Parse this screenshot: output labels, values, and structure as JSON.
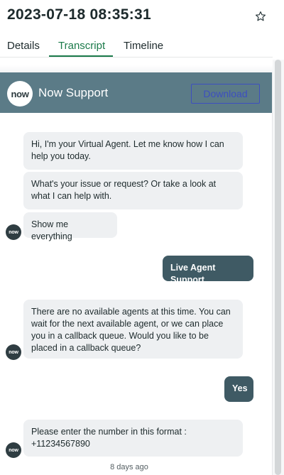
{
  "header": {
    "title": "2023-07-18 08:35:31",
    "star_icon": "star-outline-icon"
  },
  "tabs": [
    {
      "label": "Details",
      "active": false
    },
    {
      "label": "Transcript",
      "active": true
    },
    {
      "label": "Timeline",
      "active": false
    }
  ],
  "chat": {
    "logo_text": "now",
    "title": "Now Support",
    "download_label": "Download",
    "header_color": "#5b7b87",
    "agent_bubble_color": "#eef0f2",
    "user_bubble_color": "#3f5a64",
    "messages": [
      {
        "from": "agent",
        "text": "Hi, I'm your Virtual Agent. Let me know how I can help you today."
      },
      {
        "from": "agent",
        "text": "What's your issue or request? Or take a look at what I can help with."
      },
      {
        "from": "agent",
        "text": "Show me everything"
      },
      {
        "from": "user",
        "text": "Live Agent Support."
      },
      {
        "from": "agent",
        "text": "There are no available agents at this time. You can wait for the next available agent, or we can place you in a callback queue. Would you like to be placed in a callback queue?"
      },
      {
        "from": "user",
        "text": "Yes"
      },
      {
        "from": "agent",
        "text": "Please enter the number in this format : +11234567890"
      }
    ],
    "timestamp": "8 days ago"
  },
  "accent_color": "#1b7a4a"
}
